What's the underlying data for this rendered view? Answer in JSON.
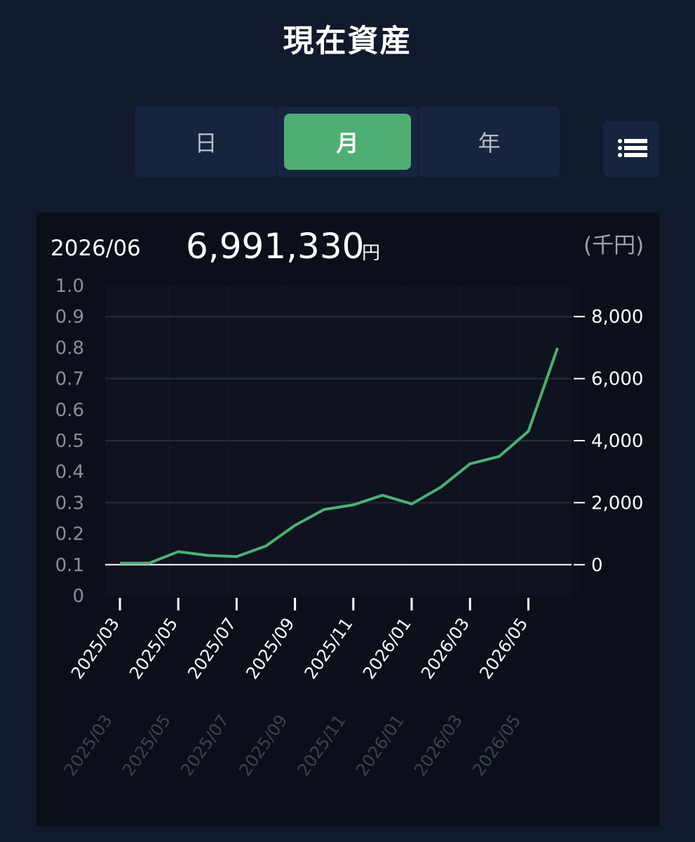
{
  "header": {
    "title": "現在資産"
  },
  "period_tabs": [
    {
      "label": "日",
      "active": false
    },
    {
      "label": "月",
      "active": true
    },
    {
      "label": "年",
      "active": false
    }
  ],
  "list_button": {
    "icon": "list-icon"
  },
  "summary": {
    "date": "2026/06",
    "value": "6,991,330",
    "currency": "円",
    "unit": "(千円)"
  },
  "colors": {
    "background": "#111a2c",
    "card": "#0b0f1a",
    "accent": "#4fae73",
    "line": "#4fae73"
  },
  "chart_data": {
    "type": "line",
    "x": [
      "2025/03",
      "2025/04",
      "2025/05",
      "2025/06",
      "2025/07",
      "2025/08",
      "2025/09",
      "2025/10",
      "2025/11",
      "2025/12",
      "2026/01",
      "2026/02",
      "2026/03",
      "2026/04",
      "2026/05",
      "2026/06"
    ],
    "x_tick_labels": [
      "2025/03",
      "2025/05",
      "2025/07",
      "2025/09",
      "2025/11",
      "2026/01",
      "2026/03",
      "2026/05"
    ],
    "series": [
      {
        "values": [
          50,
          50,
          420,
          300,
          260,
          600,
          1270,
          1780,
          1930,
          2240,
          1960,
          2500,
          3250,
          3490,
          4300,
          6991
        ]
      }
    ],
    "y_right": {
      "label": "(千円)",
      "ticks": [
        "0",
        "2,000",
        "4,000",
        "6,000",
        "8,000"
      ],
      "tick_values": [
        0,
        2000,
        4000,
        6000,
        8000
      ],
      "range": [
        -1000,
        9000
      ]
    },
    "y_left": {
      "ticks": [
        "0",
        "0.1",
        "0.2",
        "0.3",
        "0.4",
        "0.5",
        "0.6",
        "0.7",
        "0.8",
        "0.9",
        "1.0"
      ],
      "range": [
        0,
        1
      ]
    },
    "grid": true,
    "legend": false
  }
}
